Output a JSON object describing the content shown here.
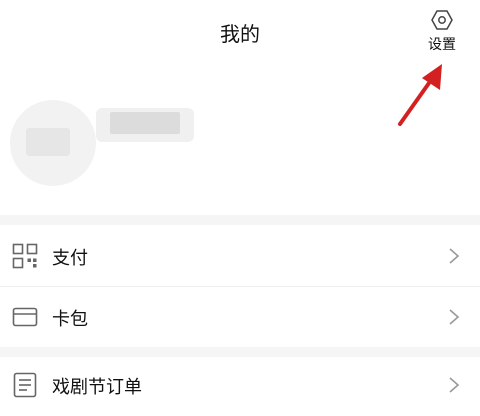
{
  "header": {
    "title": "我的",
    "settings_label": "设置"
  },
  "profile": {
    "avatar": "avatar",
    "username_redacted": true
  },
  "menu": {
    "items": [
      {
        "label": "支付",
        "icon": "qr-code-icon"
      },
      {
        "label": "卡包",
        "icon": "card-icon"
      },
      {
        "label": "戏剧节订单",
        "icon": "list-icon"
      }
    ]
  },
  "colors": {
    "annotation_arrow": "#d32020",
    "text": "#111111",
    "icon_stroke": "#666666",
    "chevron": "#999999"
  }
}
